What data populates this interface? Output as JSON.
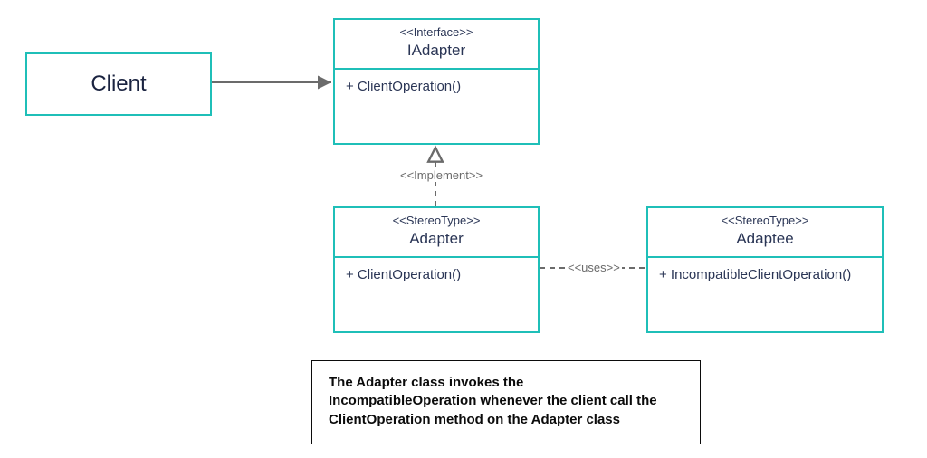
{
  "client": {
    "label": "Client"
  },
  "iadapter": {
    "stereotype": "<<Interface>>",
    "name": "IAdapter",
    "methods": [
      "+ ClientOperation()"
    ]
  },
  "adapter": {
    "stereotype": "<<StereoType>>",
    "name": "Adapter",
    "methods": [
      "+ ClientOperation()"
    ]
  },
  "adaptee": {
    "stereotype": "<<StereoType>>",
    "name": "Adaptee",
    "methods": [
      "+ IncompatibleClientOperation()"
    ]
  },
  "relations": {
    "implement_label": "<<Implement>>",
    "uses_label": "<<uses>>"
  },
  "note": {
    "line1": "The Adapter class invokes the",
    "line2": "IncompatibleOperation whenever the client call the",
    "line3": "ClientOperation method on the Adapter class"
  },
  "colors": {
    "border": "#1fbfb8",
    "text": "#2a3555",
    "connector": "#6b6b6b"
  }
}
